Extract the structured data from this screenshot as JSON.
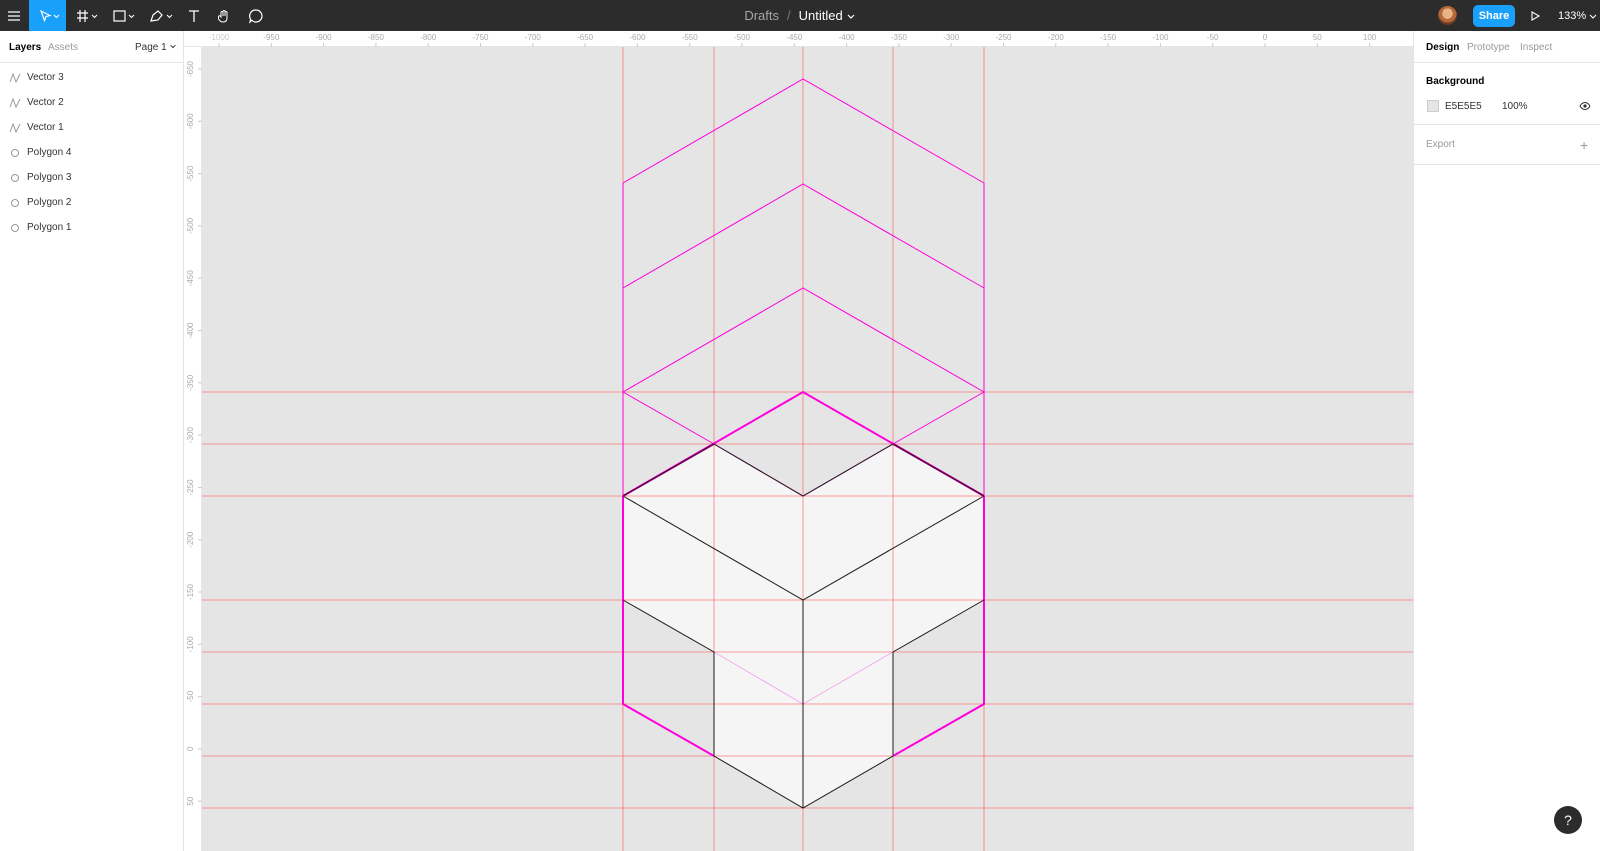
{
  "toolbar": {
    "breadcrumb_parent": "Drafts",
    "breadcrumb_separator": "/",
    "file_name": "Untitled",
    "share_label": "Share",
    "zoom_label": "133%",
    "tools": [
      "menu-icon",
      "move-icon",
      "frame-icon",
      "rectangle-icon",
      "pen-icon",
      "text-icon",
      "hand-icon",
      "comment-icon"
    ],
    "active_color": "#18a0fb",
    "bg_color": "#2c2c2c"
  },
  "left_panel": {
    "tabs": {
      "layers": "Layers",
      "assets": "Assets"
    },
    "page_label": "Page 1",
    "layers": [
      {
        "name": "Vector 3",
        "icon": "vector-icon"
      },
      {
        "name": "Vector 2",
        "icon": "vector-icon"
      },
      {
        "name": "Vector 1",
        "icon": "vector-icon"
      },
      {
        "name": "Polygon 4",
        "icon": "polygon-icon"
      },
      {
        "name": "Polygon 3",
        "icon": "polygon-icon"
      },
      {
        "name": "Polygon 2",
        "icon": "polygon-icon"
      },
      {
        "name": "Polygon 1",
        "icon": "polygon-icon"
      }
    ]
  },
  "rulers": {
    "top_labels": [
      "-1000",
      "-950",
      "-900",
      "-850",
      "-800",
      "-750",
      "-700",
      "-650",
      "-600",
      "-550",
      "-500",
      "-450",
      "-400",
      "-350",
      "-300",
      "-250",
      "-200",
      "-150",
      "-100",
      "-50",
      "0",
      "50",
      "100"
    ],
    "left_labels": [
      "-650",
      "-600",
      "-550",
      "-500",
      "-450",
      "-400",
      "-350",
      "-300",
      "-250",
      "-200",
      "-150",
      "-100",
      "-50",
      "0",
      "50"
    ]
  },
  "right_panel": {
    "tabs": {
      "design": "Design",
      "prototype": "Prototype",
      "inspect": "Inspect"
    },
    "background": {
      "title": "Background",
      "hex": "E5E5E5",
      "opacity": "100%",
      "swatch_color": "#e5e5e5"
    },
    "export": {
      "title": "Export",
      "add_symbol": "+"
    }
  },
  "canvas": {
    "guide_color": "#ff5c5c",
    "stroke_magenta": "#ff00dd",
    "cube_fill": "#f5f5f5"
  },
  "help_label": "?"
}
